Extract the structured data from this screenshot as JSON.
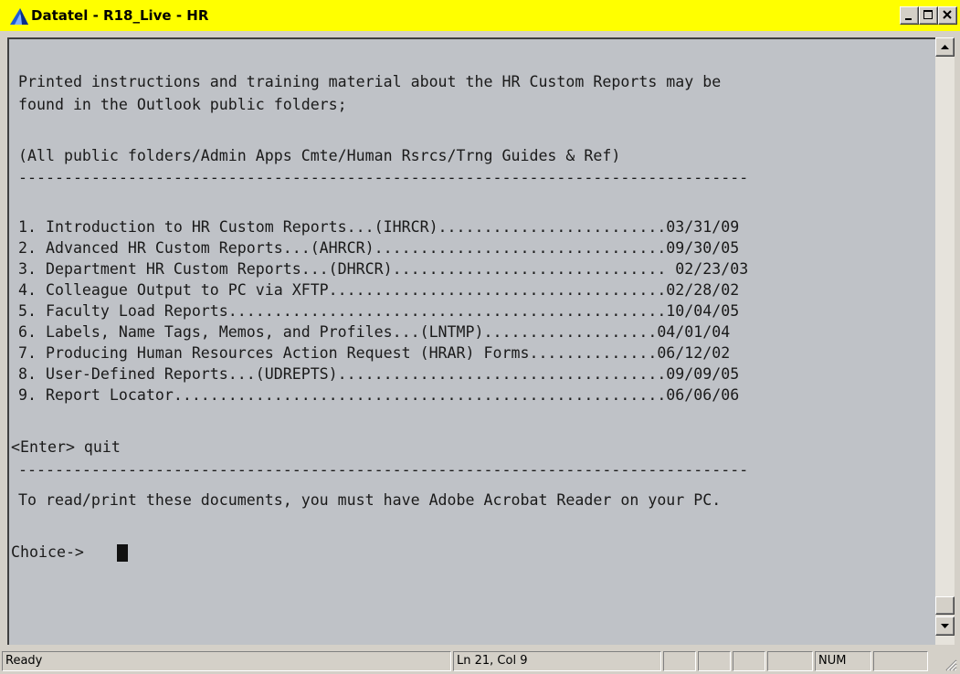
{
  "window": {
    "title": "Datatel - R18_Live - HR",
    "title_bar_color": "#ffff00",
    "controls": [
      "minimize-icon",
      "maximize-icon",
      "close-icon"
    ]
  },
  "terminal": {
    "background": "#bfc2c7",
    "intro_line1": "Printed instructions and training material about the HR Custom Reports may be",
    "intro_line2": "found in the Outlook public folders;",
    "path_line": "(All public folders/Admin Apps Cmte/Human Rsrcs/Trng Guides & Ref)",
    "separator": "--------------------------------------------------------------------------------",
    "menu_items": [
      "1. Introduction to HR Custom Reports...(IHRCR).........................03/31/09",
      "2. Advanced HR Custom Reports...(AHRCR)................................09/30/05",
      "3. Department HR Custom Reports...(DHRCR).............................. 02/23/03",
      "4. Colleague Output to PC via XFTP.....................................02/28/02",
      "5. Faculty Load Reports................................................10/04/05",
      "6. Labels, Name Tags, Memos, and Profiles...(LNTMP)...................04/01/04",
      "7. Producing Human Resources Action Request (HRAR) Forms..............06/12/02",
      "8. User-Defined Reports...(UDREPTS)....................................09/09/05",
      "9. Report Locator......................................................06/06/06"
    ],
    "enter_hint": "<Enter> quit",
    "separator2": "--------------------------------------------------------------------------------",
    "acrobat_note": "To read/print these documents, you must have Adobe Acrobat Reader on your PC.",
    "prompt": "Choice-> "
  },
  "statusbar": {
    "status": "Ready",
    "position": "Ln 21, Col 9",
    "num_indicator": "NUM"
  }
}
